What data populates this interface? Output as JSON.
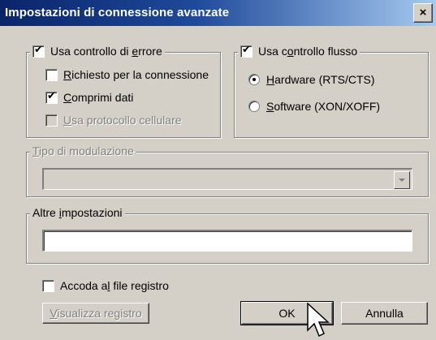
{
  "window": {
    "title": "Impostazioni di connessione avanzate",
    "close_label": "×"
  },
  "error_control": {
    "label_pre": "Usa controllo di ",
    "label_accel": "e",
    "label_post": "rrore",
    "checked": true,
    "options": [
      {
        "accel": "R",
        "rest": "ichiesto per la connessione",
        "checked": false,
        "enabled": true
      },
      {
        "accel": "C",
        "rest": "omprimi dati",
        "checked": true,
        "enabled": true
      },
      {
        "accel": "U",
        "rest": "sa protocollo cellulare",
        "checked": false,
        "enabled": false
      }
    ]
  },
  "flow_control": {
    "label_pre": "Usa c",
    "label_accel": "o",
    "label_post": "ntrollo flusso",
    "checked": true,
    "options": [
      {
        "accel": "H",
        "rest": "ardware (RTS/CTS)",
        "selected": true
      },
      {
        "accel": "S",
        "rest": "oftware (XON/XOFF)",
        "selected": false
      }
    ]
  },
  "modulation": {
    "label_accel": "T",
    "label_rest": "ipo di modulazione",
    "value": "",
    "enabled": false
  },
  "other_settings": {
    "label_pre": "Altre ",
    "label_accel": "i",
    "label_post": "mpostazioni",
    "value": ""
  },
  "log": {
    "label_pre": "Accoda a",
    "label_accel": "l",
    "label_post": " file registro",
    "checked": false
  },
  "buttons": {
    "view_log_accel": "V",
    "view_log_rest": "isualizza registro",
    "ok": "OK",
    "cancel": "Annulla"
  }
}
